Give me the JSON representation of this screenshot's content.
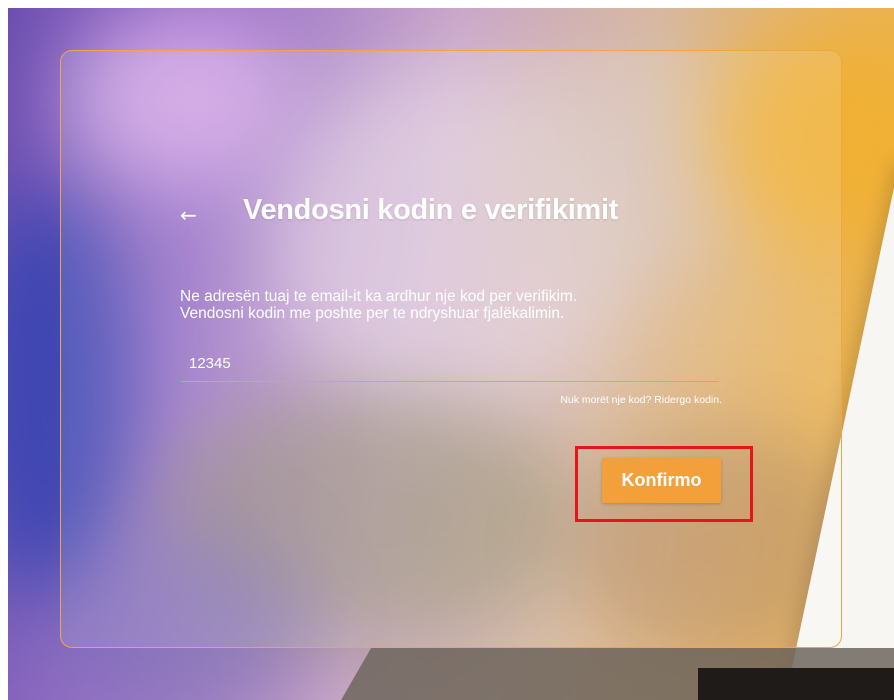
{
  "page": {
    "title": "Vendosni kodin e verifikimit",
    "back_icon": "arrow-left-icon",
    "back_glyph": "←"
  },
  "message": {
    "line1": "Ne adresën tuaj te email-it ka ardhur nje kod per verifikim.",
    "line2": "Vendosni kodin me poshte per te ndryshuar fjalëkalimin."
  },
  "code_field": {
    "value": "12345",
    "placeholder": ""
  },
  "resend": {
    "prompt": "Nuk morët nje kod?",
    "link_label": "Ridergo kodin."
  },
  "actions": {
    "confirm_label": "Konfirmo"
  },
  "colors": {
    "accent": "#f3a03b",
    "card_border": "#f0a742",
    "highlight": "#e8141c"
  }
}
